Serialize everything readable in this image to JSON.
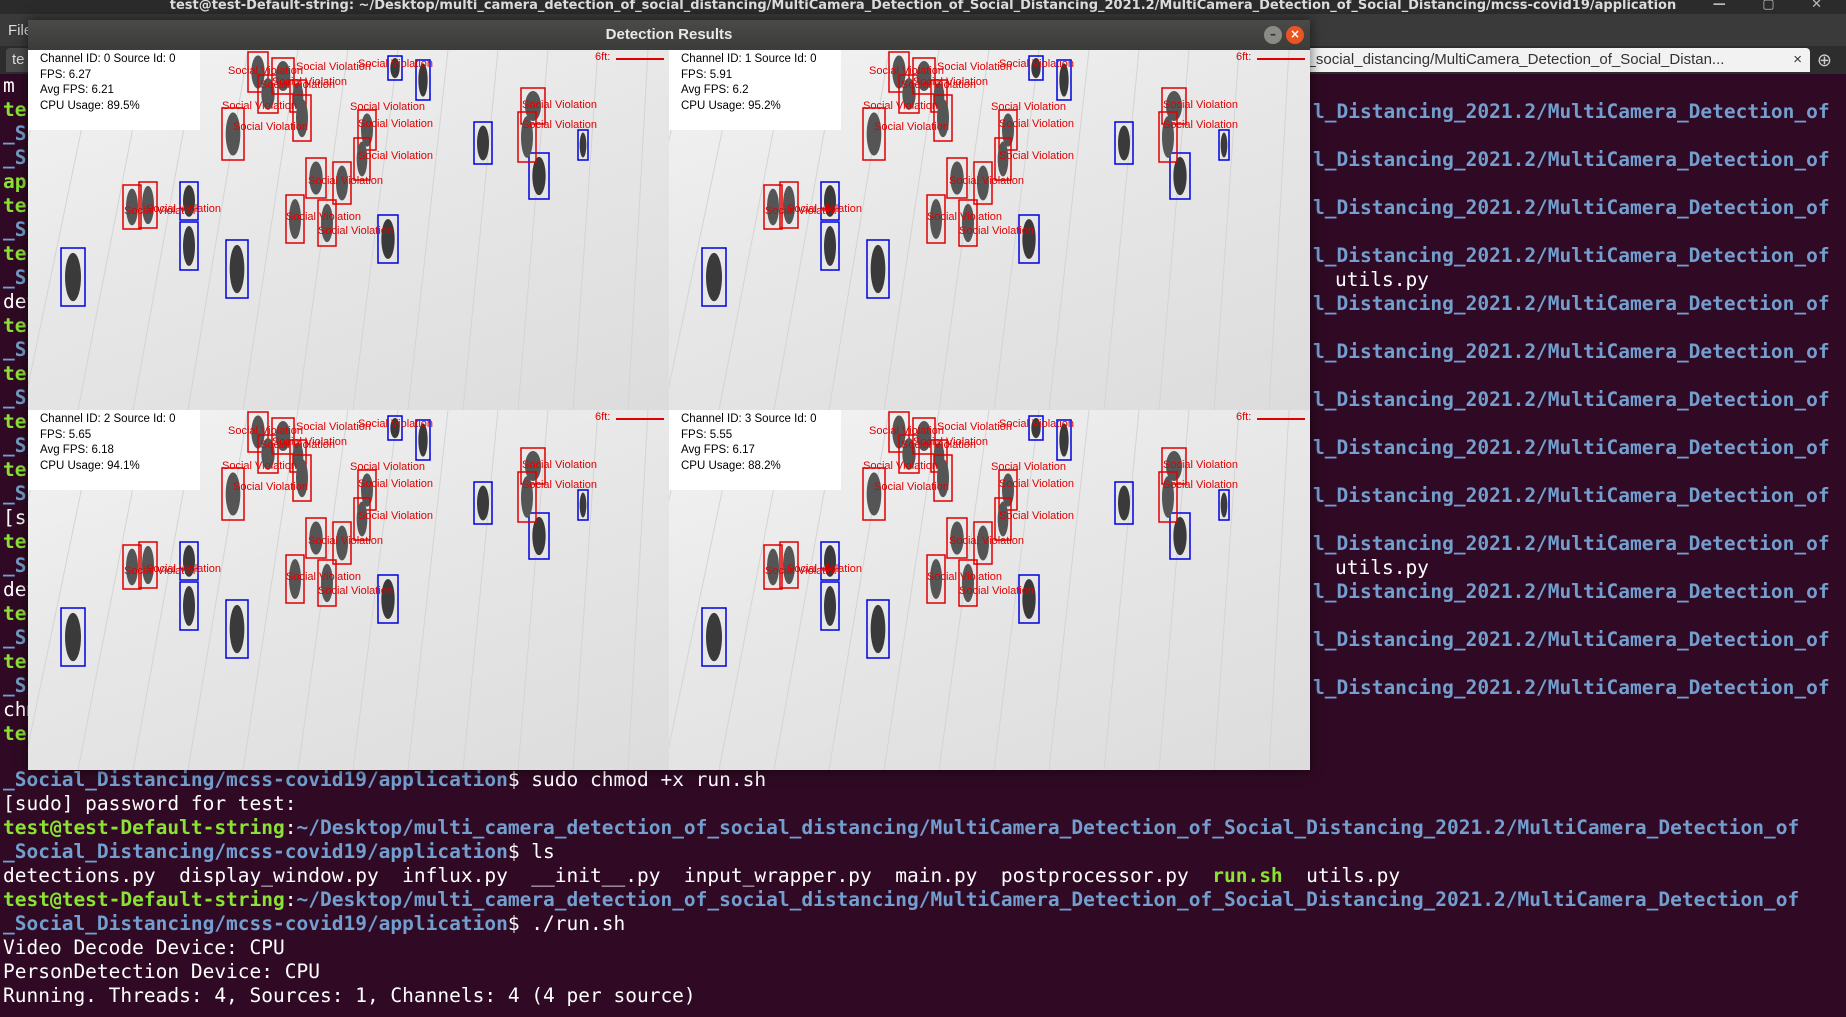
{
  "os_title": "test@test-Default-string: ~/Desktop/multi_camera_detection_of_social_distancing/MultiCamera_Detection_of_Social_Distancing_2021.2/MultiCamera_Detection_of_Social_Distancing/mcss-covid19/application",
  "menu": {
    "file": "File"
  },
  "tabs": {
    "tab1": "te",
    "tab2": "on_of_social_distancing/MultiCamera_Detection_of_Social_Distan...",
    "close": "×"
  },
  "terminal": {
    "left_fragments": [
      "m",
      "te",
      "_S",
      "_S",
      "ap",
      "te",
      "_S",
      "te",
      "_S",
      "det",
      "te",
      "_S",
      "te",
      "_S",
      "te",
      "_S",
      "te",
      "_S",
      "[s",
      "te",
      "_S",
      "det",
      "te",
      "_S",
      "te",
      "_S",
      "chm",
      "te"
    ],
    "right_path": "l_Distancing_2021.2/MultiCamera_Detection_of",
    "right_utils": "utils.py",
    "user_host": "test@test-Default-string",
    "colon": ":",
    "path": "~/Desktop/multi_camera_detection_of_social_distancing/MultiCamera_Detection_of_Social_Distancing_2021.2/MultiCamera_Detection_of",
    "path_cont": "_Social_Distancing/mcss-covid19/application",
    "prompt_chmod": "$ sudo chmod +x run.sh",
    "sudo_password": "[sudo] password for test:",
    "prompt_ls": "$ ls",
    "ls_before": "detections.py  display_window.py  influx.py  __init__.py  input_wrapper.py  main.py  postprocessor.py  ",
    "ls_exec": "run.sh",
    "ls_after": "  utils.py",
    "prompt_run": "$ ./run.sh",
    "out1": "Video Decode Device: CPU",
    "out2": "PersonDetection Device: CPU",
    "out3": "Running. Threads: 4, Sources: 1, Channels: 4 (4 per source)"
  },
  "detection_window": {
    "title": "Detection Results",
    "minimize": "–",
    "close": "×",
    "violation_label": "Social Violation",
    "six_ft": "6ft:",
    "channels": [
      {
        "channel": "Channel ID: 0 Source Id: 0",
        "fps": "FPS: 6.27",
        "avg_fps": "Avg FPS: 6.21",
        "cpu": "CPU Usage: 89.5%"
      },
      {
        "channel": "Channel ID: 1 Source Id: 0",
        "fps": "FPS: 5.91",
        "avg_fps": "Avg FPS: 6.2",
        "cpu": "CPU Usage: 95.2%"
      },
      {
        "channel": "Channel ID: 2 Source Id: 0",
        "fps": "FPS: 5.65",
        "avg_fps": "Avg FPS: 6.18",
        "cpu": "CPU Usage: 94.1%"
      },
      {
        "channel": "Channel ID: 3 Source Id: 0",
        "fps": "FPS: 5.55",
        "avg_fps": "Avg FPS: 6.17",
        "cpu": "CPU Usage: 88.2%"
      }
    ]
  },
  "colors": {
    "terminal_bg": "#300a24",
    "prompt_green": "#8ae234",
    "path_blue": "#729fcf",
    "violation_red": "#e00000",
    "safe_blue": "#0000e0"
  }
}
